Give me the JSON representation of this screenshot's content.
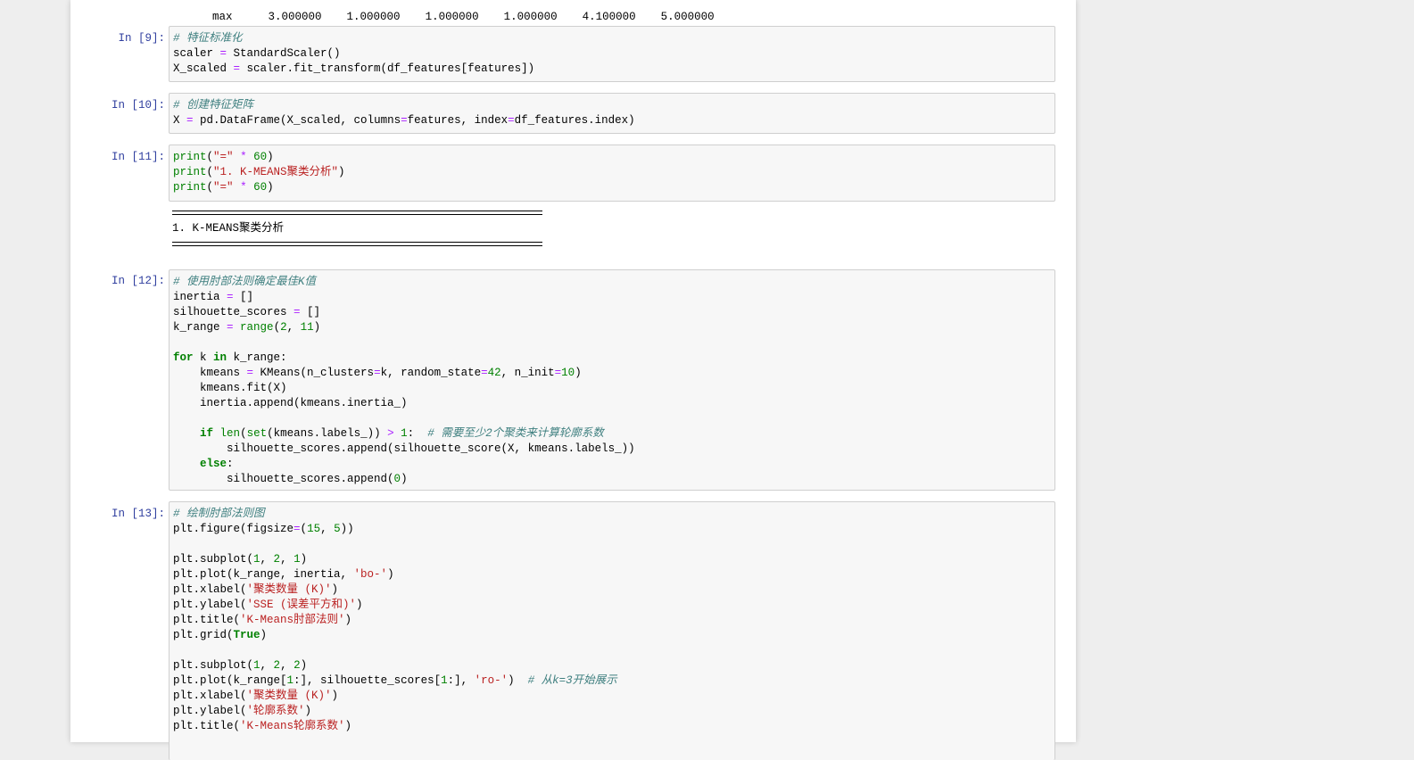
{
  "top_output": {
    "row_label": "max",
    "values": [
      "3.000000",
      "1.000000",
      "1.000000",
      "1.000000",
      "4.100000",
      "5.000000"
    ]
  },
  "cells": [
    {
      "prompt": "In  [9]:",
      "lines": [
        [
          {
            "c": "cm",
            "t": "# 特征标准化"
          }
        ],
        [
          {
            "t": "scaler "
          },
          {
            "c": "op",
            "t": "="
          },
          {
            "t": " StandardScaler()"
          }
        ],
        [
          {
            "t": "X_scaled "
          },
          {
            "c": "op",
            "t": "="
          },
          {
            "t": " scaler.fit_transform(df_features[features])"
          }
        ]
      ]
    },
    {
      "prompt": "In  [10]:",
      "lines": [
        [
          {
            "c": "cm",
            "t": "# 创建特征矩阵"
          }
        ],
        [
          {
            "t": "X "
          },
          {
            "c": "op",
            "t": "="
          },
          {
            "t": " pd.DataFrame(X_scaled, columns"
          },
          {
            "c": "op",
            "t": "="
          },
          {
            "t": "features, index"
          },
          {
            "c": "op",
            "t": "="
          },
          {
            "t": "df_features.index)"
          }
        ]
      ]
    },
    {
      "prompt": "In  [11]:",
      "lines": [
        [
          {
            "c": "bi",
            "t": "print"
          },
          {
            "t": "("
          },
          {
            "c": "str",
            "t": "\"=\""
          },
          {
            "t": " "
          },
          {
            "c": "op",
            "t": "*"
          },
          {
            "t": " "
          },
          {
            "c": "num",
            "t": "60"
          },
          {
            "t": ")"
          }
        ],
        [
          {
            "c": "bi",
            "t": "print"
          },
          {
            "t": "("
          },
          {
            "c": "str",
            "t": "\"1. K-MEANS聚类分析\""
          },
          {
            "t": ")"
          }
        ],
        [
          {
            "c": "bi",
            "t": "print"
          },
          {
            "t": "("
          },
          {
            "c": "str",
            "t": "\"=\""
          },
          {
            "t": " "
          },
          {
            "c": "op",
            "t": "*"
          },
          {
            "t": " "
          },
          {
            "c": "num",
            "t": "60"
          },
          {
            "t": ")"
          }
        ]
      ],
      "output": "1. K-MEANS聚类分析"
    },
    {
      "prompt": "In  [12]:",
      "lines": [
        [
          {
            "c": "cm",
            "t": "# 使用肘部法则确定最佳K值"
          }
        ],
        [
          {
            "t": "inertia "
          },
          {
            "c": "op",
            "t": "="
          },
          {
            "t": " []"
          }
        ],
        [
          {
            "t": "silhouette_scores "
          },
          {
            "c": "op",
            "t": "="
          },
          {
            "t": " []"
          }
        ],
        [
          {
            "t": "k_range "
          },
          {
            "c": "op",
            "t": "="
          },
          {
            "t": " "
          },
          {
            "c": "bi",
            "t": "range"
          },
          {
            "t": "("
          },
          {
            "c": "num",
            "t": "2"
          },
          {
            "t": ", "
          },
          {
            "c": "num",
            "t": "11"
          },
          {
            "t": ")"
          }
        ],
        [],
        [
          {
            "c": "kw",
            "t": "for"
          },
          {
            "t": " k "
          },
          {
            "c": "kw",
            "t": "in"
          },
          {
            "t": " k_range:"
          }
        ],
        [
          {
            "t": "    kmeans "
          },
          {
            "c": "op",
            "t": "="
          },
          {
            "t": " KMeans(n_clusters"
          },
          {
            "c": "op",
            "t": "="
          },
          {
            "t": "k, random_state"
          },
          {
            "c": "op",
            "t": "="
          },
          {
            "c": "num",
            "t": "42"
          },
          {
            "t": ", n_init"
          },
          {
            "c": "op",
            "t": "="
          },
          {
            "c": "num",
            "t": "10"
          },
          {
            "t": ")"
          }
        ],
        [
          {
            "t": "    kmeans.fit(X)"
          }
        ],
        [
          {
            "t": "    inertia.append(kmeans.inertia_)"
          }
        ],
        [],
        [
          {
            "t": "    "
          },
          {
            "c": "kw",
            "t": "if"
          },
          {
            "t": " "
          },
          {
            "c": "bi",
            "t": "len"
          },
          {
            "t": "("
          },
          {
            "c": "bi",
            "t": "set"
          },
          {
            "t": "(kmeans.labels_)) "
          },
          {
            "c": "op",
            "t": ">"
          },
          {
            "t": " "
          },
          {
            "c": "num",
            "t": "1"
          },
          {
            "t": ":  "
          },
          {
            "c": "cm",
            "t": "# 需要至少2个聚类来计算轮廓系数"
          }
        ],
        [
          {
            "t": "        silhouette_scores.append(silhouette_score(X, kmeans.labels_))"
          }
        ],
        [
          {
            "t": "    "
          },
          {
            "c": "kw",
            "t": "else"
          },
          {
            "t": ":"
          }
        ],
        [
          {
            "t": "        silhouette_scores.append("
          },
          {
            "c": "num",
            "t": "0"
          },
          {
            "t": ")"
          }
        ]
      ]
    },
    {
      "prompt": "In  [13]:",
      "lines": [
        [
          {
            "c": "cm",
            "t": "# 绘制肘部法则图"
          }
        ],
        [
          {
            "t": "plt.figure(figsize"
          },
          {
            "c": "op",
            "t": "="
          },
          {
            "t": "("
          },
          {
            "c": "num",
            "t": "15"
          },
          {
            "t": ", "
          },
          {
            "c": "num",
            "t": "5"
          },
          {
            "t": "))"
          }
        ],
        [],
        [
          {
            "t": "plt.subplot("
          },
          {
            "c": "num",
            "t": "1"
          },
          {
            "t": ", "
          },
          {
            "c": "num",
            "t": "2"
          },
          {
            "t": ", "
          },
          {
            "c": "num",
            "t": "1"
          },
          {
            "t": ")"
          }
        ],
        [
          {
            "t": "plt.plot(k_range, inertia, "
          },
          {
            "c": "str",
            "t": "'bo-'"
          },
          {
            "t": ")"
          }
        ],
        [
          {
            "t": "plt.xlabel("
          },
          {
            "c": "str",
            "t": "'聚类数量 (K)'"
          },
          {
            "t": ")"
          }
        ],
        [
          {
            "t": "plt.ylabel("
          },
          {
            "c": "str",
            "t": "'SSE (误差平方和)'"
          },
          {
            "t": ")"
          }
        ],
        [
          {
            "t": "plt.title("
          },
          {
            "c": "str",
            "t": "'K-Means肘部法则'"
          },
          {
            "t": ")"
          }
        ],
        [
          {
            "t": "plt.grid("
          },
          {
            "c": "kw",
            "t": "True"
          },
          {
            "t": ")"
          }
        ],
        [],
        [
          {
            "t": "plt.subplot("
          },
          {
            "c": "num",
            "t": "1"
          },
          {
            "t": ", "
          },
          {
            "c": "num",
            "t": "2"
          },
          {
            "t": ", "
          },
          {
            "c": "num",
            "t": "2"
          },
          {
            "t": ")"
          }
        ],
        [
          {
            "t": "plt.plot(k_range["
          },
          {
            "c": "num",
            "t": "1"
          },
          {
            "t": ":], silhouette_scores["
          },
          {
            "c": "num",
            "t": "1"
          },
          {
            "t": ":], "
          },
          {
            "c": "str",
            "t": "'ro-'"
          },
          {
            "t": ")  "
          },
          {
            "c": "cm",
            "t": "# 从k=3开始展示"
          }
        ],
        [
          {
            "t": "plt.xlabel("
          },
          {
            "c": "str",
            "t": "'聚类数量 (K)'"
          },
          {
            "t": ")"
          }
        ],
        [
          {
            "t": "plt.ylabel("
          },
          {
            "c": "str",
            "t": "'轮廓系数'"
          },
          {
            "t": ")"
          }
        ],
        [
          {
            "t": "plt.title("
          },
          {
            "c": "str",
            "t": "'K-Means轮廓系数'"
          },
          {
            "t": ")"
          }
        ]
      ]
    }
  ]
}
